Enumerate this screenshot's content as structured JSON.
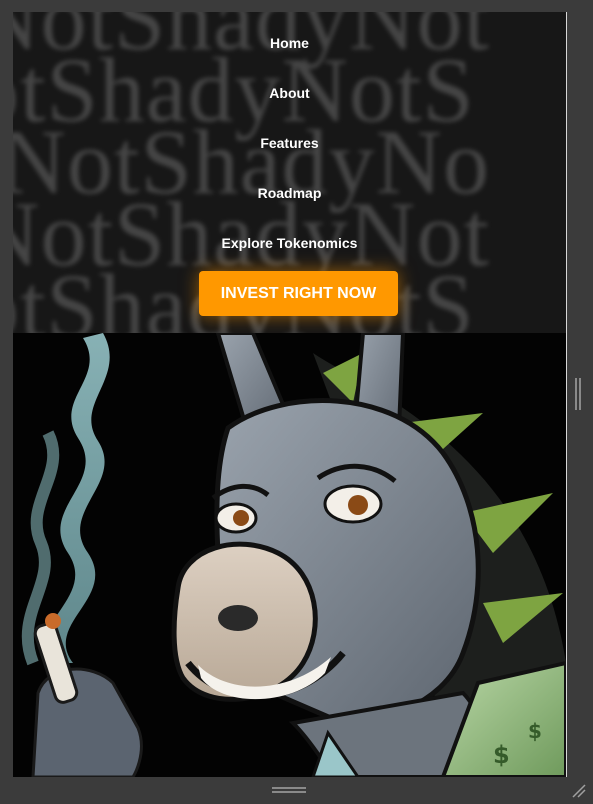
{
  "nav": {
    "items": [
      {
        "label": "Home"
      },
      {
        "label": "About"
      },
      {
        "label": "Features"
      },
      {
        "label": "Roadmap"
      },
      {
        "label": "Explore Tokenomics"
      }
    ]
  },
  "cta": {
    "label": "INVEST RIGHT NOW"
  },
  "colors": {
    "accent": "#ff9800",
    "frame": "#3b3b3b",
    "menu_bg": "#171717"
  },
  "icons": {
    "right_resize": "resize-handle-vertical-icon",
    "bottom_resize": "resize-handle-horizontal-icon",
    "corner_resize": "resize-corner-icon"
  }
}
